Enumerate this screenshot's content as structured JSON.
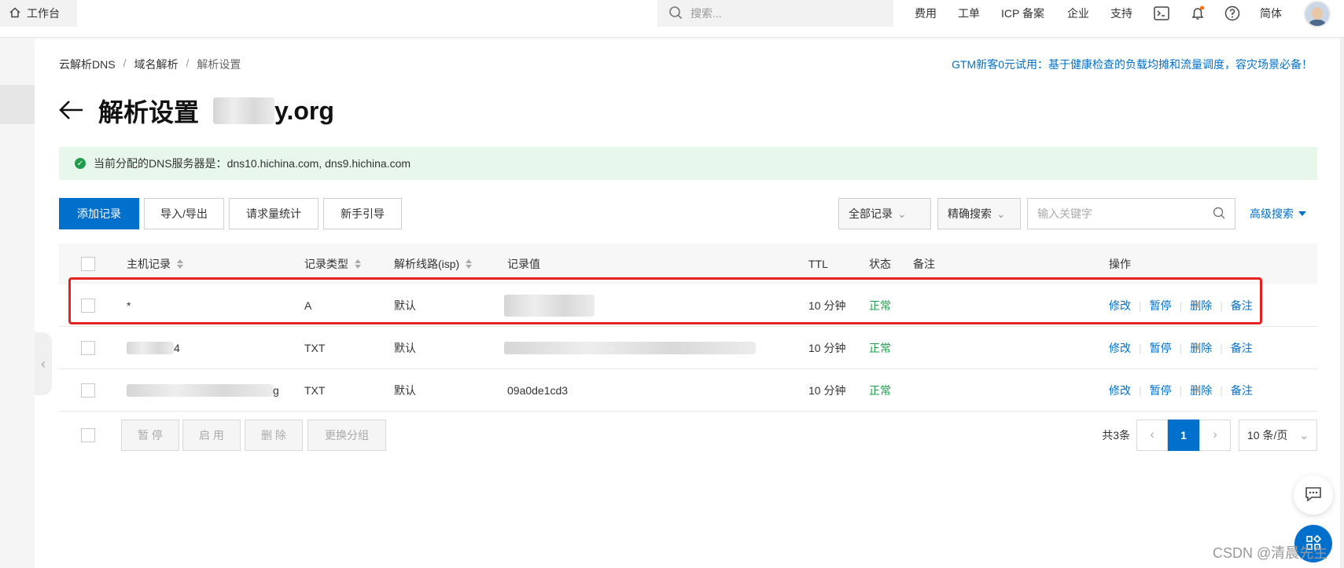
{
  "topbar": {
    "workbench": "工作台",
    "search_placeholder": "搜索...",
    "nav": [
      "费用",
      "工单",
      "ICP 备案",
      "企业",
      "支持"
    ],
    "lang": "简体"
  },
  "breadcrumb": [
    "云解析DNS",
    "域名解析",
    "解析设置"
  ],
  "promo": "GTM新客0元试用：基于健康检查的负载均摊和流量调度，容灾场景必备！",
  "page": {
    "title": "解析设置",
    "domain_suffix": "y.org"
  },
  "alert": {
    "label": "当前分配的DNS服务器是：",
    "servers": "dns10.hichina.com, dns9.hichina.com"
  },
  "toolbar": {
    "add": "添加记录",
    "import_export": "导入/导出",
    "request_stats": "请求量统计",
    "guide": "新手引导"
  },
  "filters": {
    "all_records": "全部记录",
    "exact_search": "精确搜索",
    "keyword_placeholder": "输入关键字",
    "advanced": "高级搜索"
  },
  "table": {
    "headers": {
      "host": "主机记录",
      "type": "记录类型",
      "line": "解析线路(isp)",
      "value": "记录值",
      "ttl": "TTL",
      "status": "状态",
      "remark": "备注",
      "ops": "操作"
    },
    "rows": [
      {
        "host": "*",
        "type": "A",
        "line": "默认",
        "value": "",
        "ttl": "10 分钟",
        "status": "正常"
      },
      {
        "host": "4",
        "type": "TXT",
        "line": "默认",
        "value": "",
        "ttl": "10 分钟",
        "status": "正常"
      },
      {
        "host": "g",
        "type": "TXT",
        "line": "默认",
        "value": "09a0de1cd3",
        "ttl": "10 分钟",
        "status": "正常"
      }
    ],
    "ops": [
      "修改",
      "暂停",
      "删除",
      "备注"
    ]
  },
  "footer": {
    "pause": "暂 停",
    "enable": "启 用",
    "delete": "删 除",
    "change_group": "更换分组",
    "total": "共3条",
    "current_page": "1",
    "page_size": "10 条/页"
  },
  "watermark": "CSDN @清晨先生",
  "colors": {
    "primary": "#0070cc",
    "success": "#1f9d4c",
    "highlight": "#e52222"
  }
}
